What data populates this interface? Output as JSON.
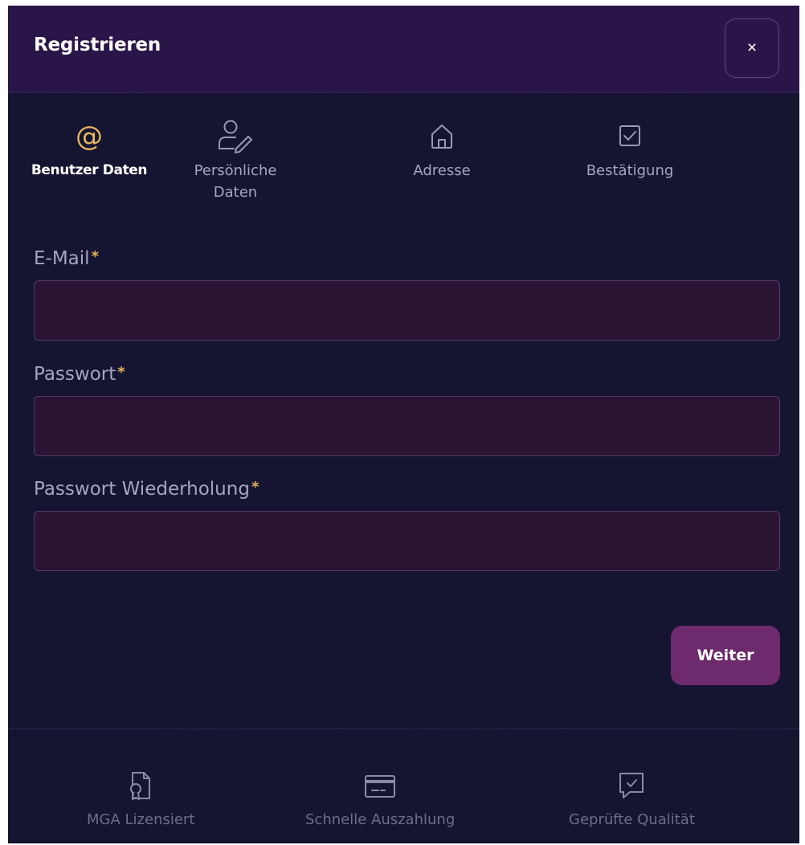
{
  "modal": {
    "title": "Registrieren",
    "close_label": "×"
  },
  "steps": [
    {
      "label": "Benutzer Daten",
      "icon": "at-sign-icon",
      "active": true
    },
    {
      "label": "Persönliche Daten",
      "icon": "user-edit-icon",
      "active": false
    },
    {
      "label": "Adresse",
      "icon": "home-icon",
      "active": false
    },
    {
      "label": "Bestätigung",
      "icon": "checkbox-icon",
      "active": false
    }
  ],
  "form": {
    "email": {
      "label": "E-Mail",
      "required_mark": "*",
      "value": "",
      "placeholder": ""
    },
    "password": {
      "label": "Passwort",
      "required_mark": "*",
      "value": "",
      "placeholder": ""
    },
    "password_repeat": {
      "label": "Passwort Wiederholung",
      "required_mark": "*",
      "value": "",
      "placeholder": ""
    },
    "next_label": "Weiter"
  },
  "footer": {
    "badges": [
      {
        "label": "MGA Lizensiert",
        "icon": "license-document-icon"
      },
      {
        "label": "Schnelle Auszahlung",
        "icon": "credit-card-icon"
      },
      {
        "label": "Geprüfte Qualität",
        "icon": "verified-chat-icon"
      }
    ]
  },
  "colors": {
    "background": "#151431",
    "header": "#2a1548",
    "accent": "#e3b65d",
    "button": "#6d2a6d",
    "input_bg": "#2b1433",
    "muted_text": "#a7a4bd"
  }
}
